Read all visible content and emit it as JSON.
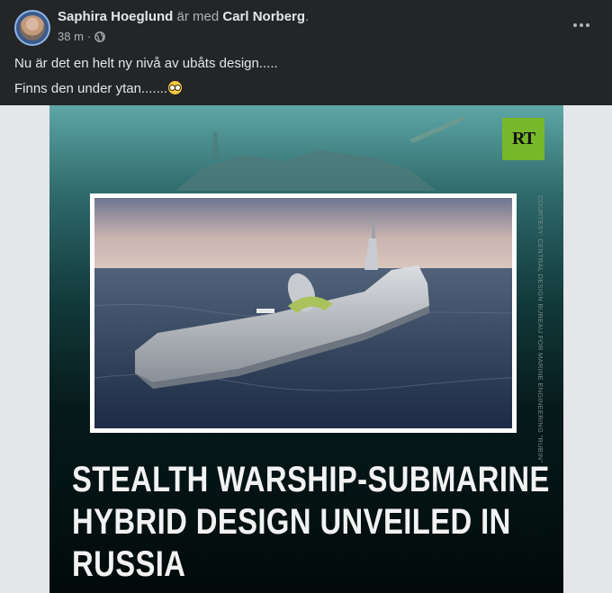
{
  "post": {
    "author": "Saphira Hoeglund",
    "with_text": " är med ",
    "tagged": "Carl Norberg",
    "tagged_suffix": ".",
    "time": "38 m",
    "time_sep": " ·",
    "audience_icon": "globe-icon",
    "text_line1": "Nu är det en helt ny nivå av ubåts design.....",
    "text_line2": "Finns den under ytan.......",
    "emoji": "flushed-face-emoji"
  },
  "media": {
    "logo": "RT",
    "credit": "COURTESY: CENTRAL DESIGN BUREAU FOR MARINE ENGINEERING \"RUBIN\"",
    "headline_line1": "STEALTH WARSHIP-SUBMARINE",
    "headline_line2": "HYBRID DESIGN UNVEILED IN",
    "headline_line3": "RUSSIA",
    "colors": {
      "logo_bg": "#77b82a",
      "frame": "#ffffff"
    }
  }
}
